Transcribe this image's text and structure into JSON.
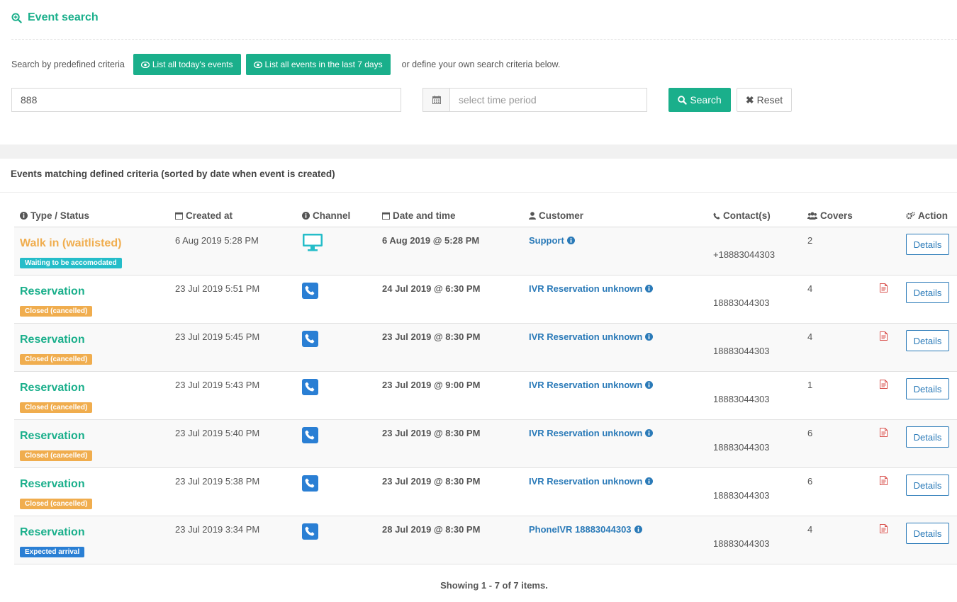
{
  "header": {
    "title": "Event search"
  },
  "predefined": {
    "label": "Search by predefined criteria",
    "today_label": "List all today's events",
    "week_label": "List all events in the last 7 days",
    "or_text": "or define your own search criteria below."
  },
  "search": {
    "value": "888",
    "date_placeholder": "select time period",
    "search_label": "Search",
    "reset_label": "Reset"
  },
  "panel": {
    "title": "Events matching defined criteria (sorted by date when event is created)"
  },
  "table": {
    "headers": {
      "type": "Type / Status",
      "created": "Created at",
      "channel": "Channel",
      "datetime": "Date and time",
      "customer": "Customer",
      "contacts": "Contact(s)",
      "covers": "Covers",
      "action": "Action"
    },
    "rows": [
      {
        "type": "Walk in (waitlisted)",
        "kind": "walk",
        "status": "Waiting to be accomodated",
        "status_kind": "wait",
        "created": "6 Aug 2019 5:28 PM",
        "channel": "desktop-icon",
        "datetime": "6 Aug 2019 @ 5:28 PM",
        "customer": "Support",
        "contact": "+18883044303",
        "covers": "2",
        "has_note": false,
        "action": "Details"
      },
      {
        "type": "Reservation",
        "kind": "res",
        "status": "Closed (cancelled)",
        "status_kind": "closed",
        "created": "23 Jul 2019 5:51 PM",
        "channel": "phone-icon",
        "datetime": "24 Jul 2019 @ 6:30 PM",
        "customer": "IVR Reservation unknown",
        "contact": "18883044303",
        "covers": "4",
        "has_note": true,
        "action": "Details"
      },
      {
        "type": "Reservation",
        "kind": "res",
        "status": "Closed (cancelled)",
        "status_kind": "closed",
        "created": "23 Jul 2019 5:45 PM",
        "channel": "phone-icon",
        "datetime": "23 Jul 2019 @ 8:30 PM",
        "customer": "IVR Reservation unknown",
        "contact": "18883044303",
        "covers": "4",
        "has_note": true,
        "action": "Details"
      },
      {
        "type": "Reservation",
        "kind": "res",
        "status": "Closed (cancelled)",
        "status_kind": "closed",
        "created": "23 Jul 2019 5:43 PM",
        "channel": "phone-icon",
        "datetime": "23 Jul 2019 @ 9:00 PM",
        "customer": "IVR Reservation unknown",
        "contact": "18883044303",
        "covers": "1",
        "has_note": true,
        "action": "Details"
      },
      {
        "type": "Reservation",
        "kind": "res",
        "status": "Closed (cancelled)",
        "status_kind": "closed",
        "created": "23 Jul 2019 5:40 PM",
        "channel": "phone-icon",
        "datetime": "23 Jul 2019 @ 8:30 PM",
        "customer": "IVR Reservation unknown",
        "contact": "18883044303",
        "covers": "6",
        "has_note": true,
        "action": "Details"
      },
      {
        "type": "Reservation",
        "kind": "res",
        "status": "Closed (cancelled)",
        "status_kind": "closed",
        "created": "23 Jul 2019 5:38 PM",
        "channel": "phone-icon",
        "datetime": "23 Jul 2019 @ 8:30 PM",
        "customer": "IVR Reservation unknown",
        "contact": "18883044303",
        "covers": "6",
        "has_note": true,
        "action": "Details"
      },
      {
        "type": "Reservation",
        "kind": "res",
        "status": "Expected arrival",
        "status_kind": "expected",
        "created": "23 Jul 2019 3:34 PM",
        "channel": "phone-icon",
        "datetime": "28 Jul 2019 @ 8:30 PM",
        "customer": "PhoneIVR 18883044303",
        "contact": "18883044303",
        "covers": "4",
        "has_note": true,
        "action": "Details"
      }
    ]
  },
  "footer": {
    "summary": "Showing 1 - 7 of 7 items."
  },
  "colors": {
    "accent": "#1aaf8b",
    "link": "#2a7ab8",
    "warning": "#f0ad4e",
    "info": "#25bdc9",
    "primary": "#2a7fd4"
  }
}
